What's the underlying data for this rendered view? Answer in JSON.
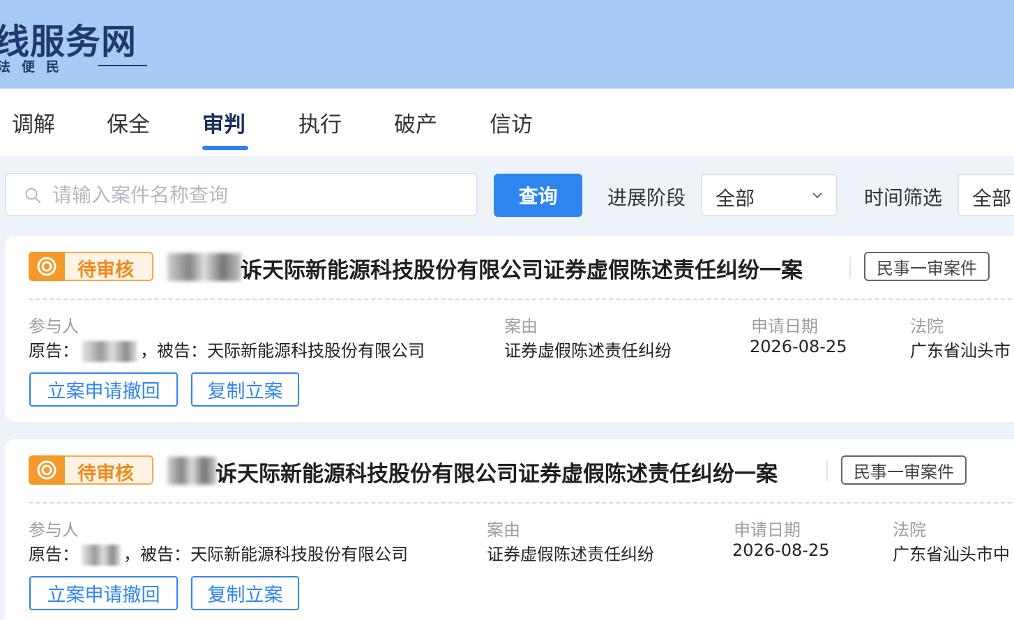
{
  "site": {
    "title": "线服务网",
    "subtitle": "法便民"
  },
  "tabs": [
    {
      "label": "调解",
      "active": false
    },
    {
      "label": "保全",
      "active": false
    },
    {
      "label": "审判",
      "active": true
    },
    {
      "label": "执行",
      "active": false
    },
    {
      "label": "破产",
      "active": false
    },
    {
      "label": "信访",
      "active": false
    }
  ],
  "search": {
    "placeholder": "请输入案件名称查询",
    "value": "",
    "button_label": "查询"
  },
  "filters": {
    "stage_label": "进展阶段",
    "stage_value": "全部",
    "time_label": "时间筛选",
    "time_value": "全部"
  },
  "cases": [
    {
      "status": "待审核",
      "title_suffix": "诉天际新能源科技股份有限公司证券虚假陈述责任纠纷一案",
      "type_tag": "民事一审案件",
      "participants_label": "参与人",
      "plaintiff_label": "原告：",
      "defendant_label": "，被告：天际新能源科技股份有限公司",
      "cause_label": "案由",
      "cause_value": "证券虚假陈述责任纠纷",
      "date_label": "申请日期",
      "date_value": "2026-08-25",
      "court_label": "法院",
      "court_value": "广东省汕头市",
      "withdraw_label": "立案申请撤回",
      "copy_label": "复制立案"
    },
    {
      "status": "待审核",
      "title_suffix": "诉天际新能源科技股份有限公司证券虚假陈述责任纠纷一案",
      "type_tag": "民事一审案件",
      "participants_label": "参与人",
      "plaintiff_label": "原告：",
      "defendant_label": "，被告：天际新能源科技股份有限公司",
      "cause_label": "案由",
      "cause_value": "证券虚假陈述责任纠纷",
      "date_label": "申请日期",
      "date_value": "2026-08-25",
      "court_label": "法院",
      "court_value": "广东省汕头市中",
      "withdraw_label": "立案申请撤回",
      "copy_label": "复制立案"
    }
  ],
  "colors": {
    "primary": "#2f85f0",
    "header_bg": "#a7cbf6",
    "status_orange": "#f39a2a"
  }
}
